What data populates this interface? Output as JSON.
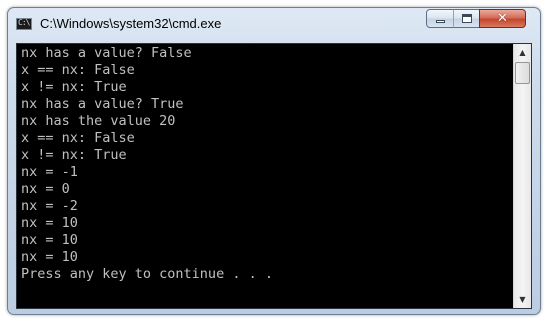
{
  "window": {
    "title": "C:\\Windows\\system32\\cmd.exe",
    "icon": "cmd-icon",
    "icon_text": "C:\\"
  },
  "controls": {
    "minimize_icon": "minimize-icon",
    "maximize_icon": "maximize-icon",
    "close_icon": "close-icon",
    "close_glyph": "✕"
  },
  "console": {
    "background": "#000000",
    "foreground": "#c0c0c0",
    "lines": [
      "nx has a value? False",
      "x == nx: False",
      "x != nx: True",
      "nx has a value? True",
      "nx has the value 20",
      "x == nx: False",
      "x != nx: True",
      "nx = -1",
      "nx = 0",
      "nx = -2",
      "nx = 10",
      "nx = 10",
      "nx = 10",
      "Press any key to continue . . ."
    ]
  },
  "scrollbar": {
    "up_arrow": "▲",
    "down_arrow": "▼"
  }
}
